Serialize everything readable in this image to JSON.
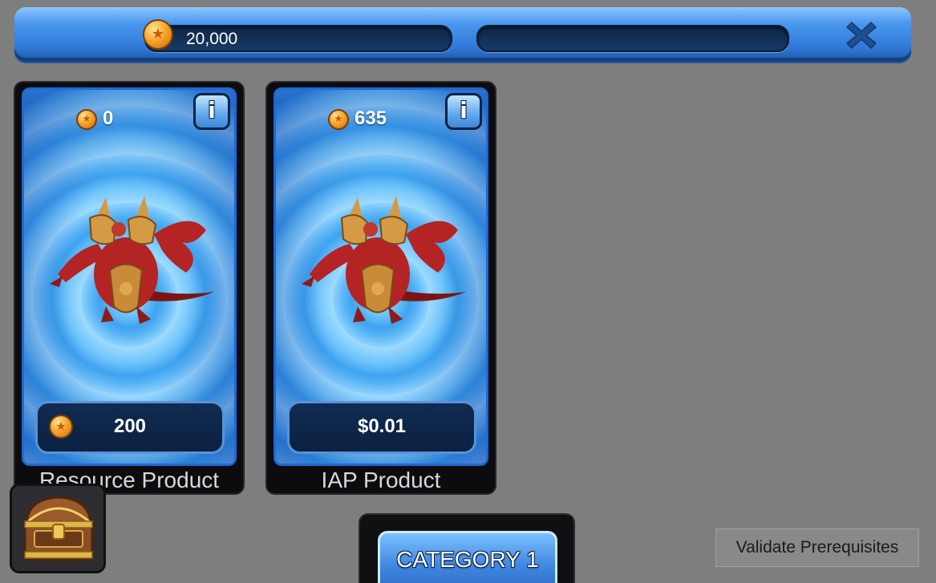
{
  "hud": {
    "gold_amount": "20,000",
    "secondary_amount": ""
  },
  "products": [
    {
      "title": "Resource Product",
      "top_cost": "0",
      "price_label": "200",
      "price_currency": "coin",
      "info_label": "i"
    },
    {
      "title": "IAP Product",
      "top_cost": "635",
      "price_label": "$0.01",
      "price_currency": "none",
      "info_label": "i"
    }
  ],
  "category": {
    "label": "CATEGORY 1"
  },
  "actions": {
    "validate_label": "Validate Prerequisites"
  },
  "icons": {
    "currency": "gold-coin-icon",
    "close": "close-x-icon",
    "info": "info-icon",
    "chest": "treasure-chest-icon"
  },
  "colors": {
    "topbar": "#3b86e2",
    "card_border": "#1e67d8",
    "coin": "#f6a72a",
    "background": "#7e7e7e"
  }
}
